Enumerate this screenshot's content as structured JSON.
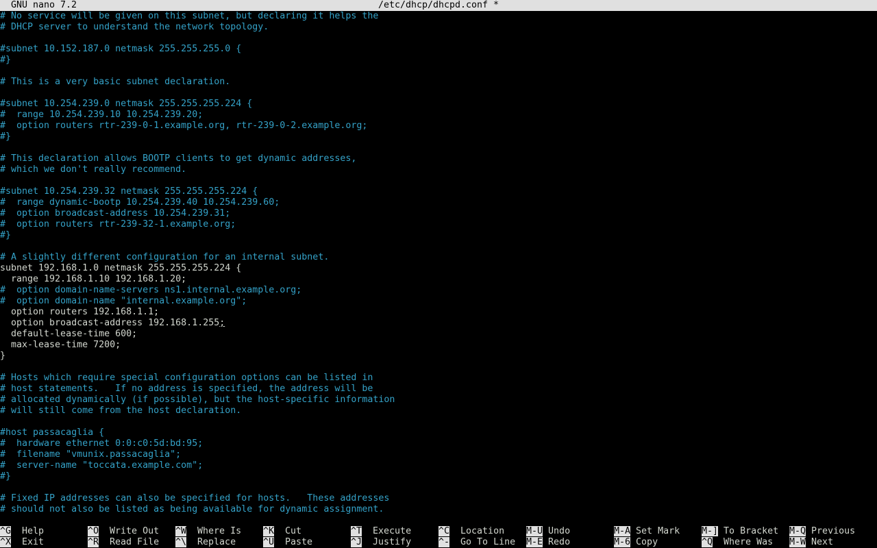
{
  "titlebar": {
    "app": "GNU nano 7.2",
    "file": "/etc/dhcp/dhcpd.conf *"
  },
  "editor": {
    "lines": [
      {
        "text": "# No service will be given on this subnet, but declaring it helps the",
        "type": "comment"
      },
      {
        "text": "# DHCP server to understand the network topology.",
        "type": "comment"
      },
      {
        "text": "",
        "type": "code"
      },
      {
        "text": "#subnet 10.152.187.0 netmask 255.255.255.0 {",
        "type": "comment"
      },
      {
        "text": "#}",
        "type": "comment"
      },
      {
        "text": "",
        "type": "code"
      },
      {
        "text": "# This is a very basic subnet declaration.",
        "type": "comment"
      },
      {
        "text": "",
        "type": "code"
      },
      {
        "text": "#subnet 10.254.239.0 netmask 255.255.255.224 {",
        "type": "comment"
      },
      {
        "text": "#  range 10.254.239.10 10.254.239.20;",
        "type": "comment"
      },
      {
        "text": "#  option routers rtr-239-0-1.example.org, rtr-239-0-2.example.org;",
        "type": "comment"
      },
      {
        "text": "#}",
        "type": "comment"
      },
      {
        "text": "",
        "type": "code"
      },
      {
        "text": "# This declaration allows BOOTP clients to get dynamic addresses,",
        "type": "comment"
      },
      {
        "text": "# which we don't really recommend.",
        "type": "comment"
      },
      {
        "text": "",
        "type": "code"
      },
      {
        "text": "#subnet 10.254.239.32 netmask 255.255.255.224 {",
        "type": "comment"
      },
      {
        "text": "#  range dynamic-bootp 10.254.239.40 10.254.239.60;",
        "type": "comment"
      },
      {
        "text": "#  option broadcast-address 10.254.239.31;",
        "type": "comment"
      },
      {
        "text": "#  option routers rtr-239-32-1.example.org;",
        "type": "comment"
      },
      {
        "text": "#}",
        "type": "comment"
      },
      {
        "text": "",
        "type": "code"
      },
      {
        "text": "# A slightly different configuration for an internal subnet.",
        "type": "comment"
      },
      {
        "text": "subnet 192.168.1.0 netmask 255.255.255.224 {",
        "type": "code"
      },
      {
        "text": "  range 192.168.1.10 192.168.1.20;",
        "type": "code"
      },
      {
        "text": "#  option domain-name-servers ns1.internal.example.org;",
        "type": "comment"
      },
      {
        "text": "#  option domain-name \"internal.example.org\";",
        "type": "comment"
      },
      {
        "text": "  option routers 192.168.1.1;",
        "type": "code"
      },
      {
        "text": "  option broadcast-address 192.168.1.255",
        "type": "code",
        "cursor": ";"
      },
      {
        "text": "  default-lease-time 600;",
        "type": "code"
      },
      {
        "text": "  max-lease-time 7200;",
        "type": "code"
      },
      {
        "text": "}",
        "type": "code"
      },
      {
        "text": "",
        "type": "code"
      },
      {
        "text": "# Hosts which require special configuration options can be listed in",
        "type": "comment"
      },
      {
        "text": "# host statements.   If no address is specified, the address will be",
        "type": "comment"
      },
      {
        "text": "# allocated dynamically (if possible), but the host-specific information",
        "type": "comment"
      },
      {
        "text": "# will still come from the host declaration.",
        "type": "comment"
      },
      {
        "text": "",
        "type": "code"
      },
      {
        "text": "#host passacaglia {",
        "type": "comment"
      },
      {
        "text": "#  hardware ethernet 0:0:c0:5d:bd:95;",
        "type": "comment"
      },
      {
        "text": "#  filename \"vmunix.passacaglia\";",
        "type": "comment"
      },
      {
        "text": "#  server-name \"toccata.example.com\";",
        "type": "comment"
      },
      {
        "text": "#}",
        "type": "comment"
      },
      {
        "text": "",
        "type": "code"
      },
      {
        "text": "# Fixed IP addresses can also be specified for hosts.   These addresses",
        "type": "comment"
      },
      {
        "text": "# should not also be listed as being available for dynamic assignment.",
        "type": "comment"
      }
    ]
  },
  "shortcuts": {
    "row1": [
      {
        "key": "^G",
        "label": "Help"
      },
      {
        "key": "^O",
        "label": "Write Out"
      },
      {
        "key": "^W",
        "label": "Where Is"
      },
      {
        "key": "^K",
        "label": "Cut"
      },
      {
        "key": "^T",
        "label": "Execute"
      },
      {
        "key": "^C",
        "label": "Location"
      },
      {
        "key": "M-U",
        "label": "Undo"
      },
      {
        "key": "M-A",
        "label": "Set Mark"
      },
      {
        "key": "M-]",
        "label": "To Bracket"
      },
      {
        "key": "M-Q",
        "label": "Previous"
      }
    ],
    "row2": [
      {
        "key": "^X",
        "label": "Exit"
      },
      {
        "key": "^R",
        "label": "Read File"
      },
      {
        "key": "^\\",
        "label": "Replace"
      },
      {
        "key": "^U",
        "label": "Paste"
      },
      {
        "key": "^J",
        "label": "Justify"
      },
      {
        "key": "^-",
        "label": "Go To Line"
      },
      {
        "key": "M-E",
        "label": "Redo"
      },
      {
        "key": "M-6",
        "label": "Copy"
      },
      {
        "key": "^Q",
        "label": "Where Was"
      },
      {
        "key": "M-W",
        "label": "Next"
      }
    ]
  },
  "colors": {
    "background": "#000000",
    "text": "#d3d7cf",
    "comment": "#34a2c8",
    "bar": "#e0e0e0"
  }
}
